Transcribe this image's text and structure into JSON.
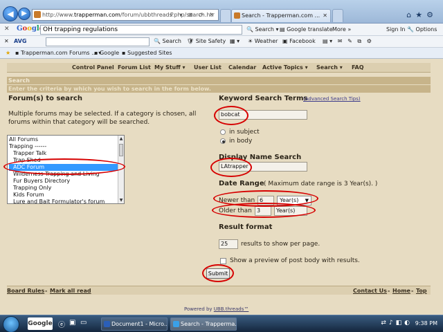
{
  "browser": {
    "url_prefix": "http://www.",
    "url_domain": "trapperman.com",
    "url_rest": "/forum/ubbthreads.php/search.htr",
    "tab_title": "Search - Trapperman.com ...",
    "addr_tools": "P ▾ ⊠ ⟳ ✕"
  },
  "google_toolbar": {
    "logo": "Google",
    "query": "OH trapping regulations",
    "search": "Search",
    "translate": "Google translate",
    "more": "More »",
    "signin": "Sign In",
    "options": "Options"
  },
  "avg_toolbar": {
    "badge": "AVG",
    "search": "Search",
    "site_safety": "Site Safety",
    "weather": "Weather",
    "facebook": "Facebook"
  },
  "favorites_bar": {
    "items": [
      "Trapperman.com Forums ...",
      "Google",
      "Suggested Sites"
    ]
  },
  "forum": {
    "menu": [
      "Control Panel",
      "Forum List",
      "My Stuff ▾",
      "User List",
      "Calendar",
      "Active Topics ▾",
      "Search ▾",
      "FAQ"
    ],
    "section_title": "Search",
    "section_subtitle": "Enter the criteria by which you wish to search in the form below.",
    "forums_heading": "Forum(s) to search",
    "forums_help": "Multiple forums may be selected. If a category is chosen, all forums within that category will be searched.",
    "forum_list": [
      "All Forums",
      "Trapping ------",
      "Trapper Talk",
      "Trap Shed",
      "ADC Forum",
      "Wilderness Trapping and Living",
      "Fur Buyers Directory",
      "Trapping Only",
      "Kids Forum",
      "Lure and Bait Formulator's forum"
    ],
    "forum_selected": "ADC Forum",
    "keyword_heading": "Keyword Search Terms",
    "advanced_tips": "(Advanced Search Tips)",
    "keyword_value": "bobcat",
    "in_subject": "in subject",
    "in_body": "in body",
    "display_name_heading": "Display Name Search",
    "display_name_value": "LAtrapper",
    "date_range_heading": "Date Range",
    "date_range_note": "( Maximum date range is 3 Year(s). )",
    "newer_than": "Newer than",
    "newer_value": "6",
    "newer_unit": "Year(s)",
    "older_than": "Older than",
    "older_value": "3",
    "older_unit": "Year(s)",
    "result_format_heading": "Result format",
    "results_value": "25",
    "results_label": "results to show per page.",
    "preview_label": "Show a preview of post body with results.",
    "submit": "Submit",
    "footer_left": [
      "Board Rules",
      "Mark all read"
    ],
    "footer_right": [
      "Contact Us",
      "Home",
      "Top"
    ],
    "powered_prefix": "Powered by ",
    "powered_link": "UBB.threads™"
  },
  "taskbar": {
    "google": "Google",
    "items": [
      "Document1 - Micro...",
      "Search - Trapperma..."
    ],
    "clock": "9:38 PM"
  },
  "colors": {
    "annotation": "#d60000",
    "page_bg": "#e7dcc2",
    "header_bg": "#c7b48a",
    "selection": "#3399ff"
  }
}
